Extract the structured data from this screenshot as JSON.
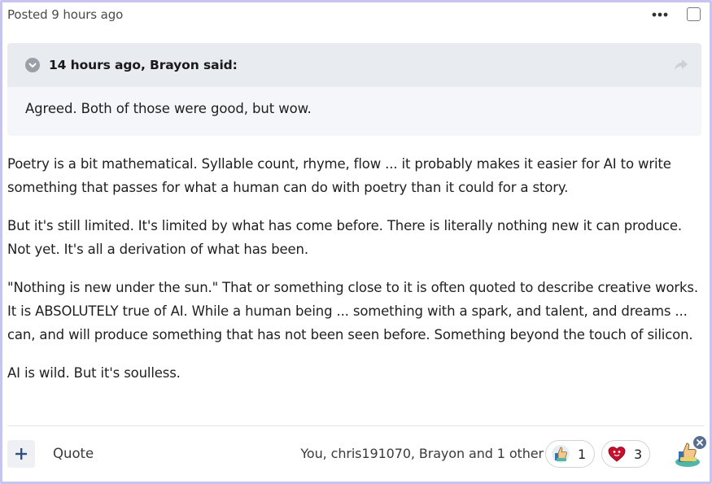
{
  "post": {
    "posted_prefix": "Posted",
    "posted_time": "9 hours ago"
  },
  "quote": {
    "attribution": "14 hours ago, Brayon said:",
    "text": "Agreed. Both of those were good, but wow."
  },
  "body": {
    "paragraphs": [
      "Poetry is a bit mathematical. Syllable count, rhyme, flow ... it probably makes it easier for AI to write something that passes for what a human can do with poetry than it could for a story.",
      "But it's still limited. It's limited by what has come before. There is literally nothing new it can produce. Not yet. It's all a derivation of what has been.",
      "\"Nothing is new under the sun.\" That or something close to it is often quoted to describe creative works. It is ABSOLUTELY true of AI. While a human being ... something with a spark, and talent, and dreams ... can, and will produce something that has not been seen before. Something beyond the touch of silicon.",
      "AI is wild. But it's soulless."
    ]
  },
  "footer": {
    "quote_label": "Quote",
    "reactors_text": "You, chris191070, Brayon and 1 other",
    "reactions": [
      {
        "icon": "thumbs-up-icon",
        "count": "1"
      },
      {
        "icon": "heart-icon",
        "count": "3"
      }
    ]
  },
  "colors": {
    "frame": "#c7c4ef",
    "quote_header_bg": "#e8ebf0",
    "quote_body_bg": "#f4f6f9",
    "accent": "#2f4f86"
  }
}
